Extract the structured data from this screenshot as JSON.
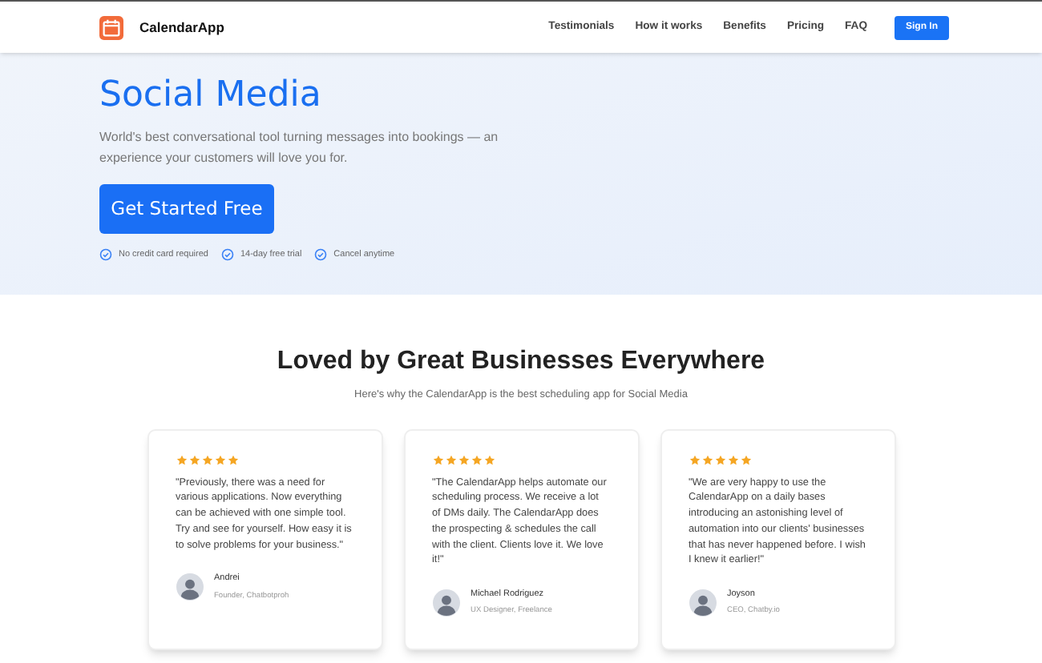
{
  "header": {
    "brand": "CalendarApp",
    "nav": [
      "Testimonials",
      "How it works",
      "Benefits",
      "Pricing",
      "FAQ"
    ],
    "sign_in": "Sign In"
  },
  "hero": {
    "title": "Social Media",
    "description": "World's best conversational tool turning messages into bookings — an experience your customers will love you for.",
    "cta": "Get Started Free",
    "features": [
      "No credit card required",
      "14-day free trial",
      "Cancel anytime"
    ]
  },
  "testimonials": {
    "title": "Loved by Great Businesses Everywhere",
    "subtitle": "Here's why the CalendarApp is the best scheduling app for Social Media",
    "items": [
      {
        "stars": 5,
        "quote": "\"Previously, there was a need for various applications. Now everything can be achieved with one simple tool. Try and see for yourself. How easy it is to solve problems for your business.\"",
        "name": "Andrei",
        "role": "Founder, Chatbotproh"
      },
      {
        "stars": 5,
        "quote": "\"The CalendarApp helps automate our scheduling process. We receive a lot of DMs daily. The CalendarApp does the prospecting & schedules the call with the client. Clients love it. We love it!\"",
        "name": "Michael Rodriguez",
        "role": "UX Designer, Freelance"
      },
      {
        "stars": 5,
        "quote": "\"We are very happy to use the CalendarApp on a daily bases introducing an astonishing level of automation into our clients' businesses that has never happened before. I wish I knew it earlier!\"",
        "name": "Joyson",
        "role": "CEO, Chatby.io"
      }
    ]
  }
}
